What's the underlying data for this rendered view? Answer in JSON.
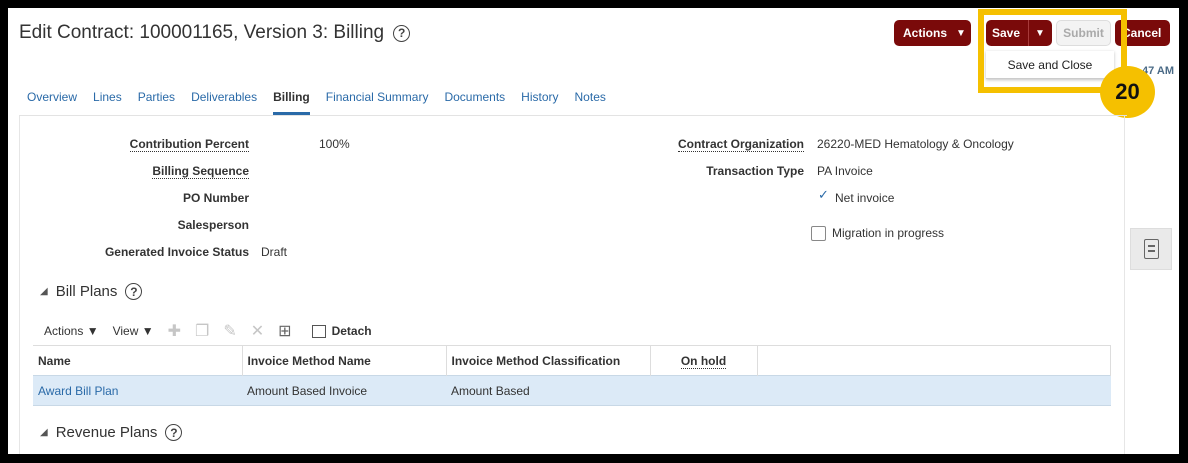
{
  "header": {
    "title": "Edit Contract: 100001165, Version 3: Billing",
    "help_glyph": "?",
    "timestamp": "47 AM"
  },
  "toolbar_buttons": {
    "actions_label": "Actions",
    "save_label": "Save",
    "submit_label": "Submit",
    "cancel_label": "Cancel"
  },
  "save_menu": {
    "items": [
      "Save and Close"
    ]
  },
  "annotation": {
    "step_number": "20",
    "highlight_color": "#f5c000"
  },
  "tabs": [
    {
      "label": "Overview"
    },
    {
      "label": "Lines"
    },
    {
      "label": "Parties"
    },
    {
      "label": "Deliverables"
    },
    {
      "label": "Billing",
      "active": true
    },
    {
      "label": "Financial Summary"
    },
    {
      "label": "Documents"
    },
    {
      "label": "History"
    },
    {
      "label": "Notes"
    }
  ],
  "billing": {
    "contribution_percent_label": "Contribution Percent",
    "contribution_percent_value": "100%",
    "billing_sequence_label": "Billing Sequence",
    "po_number_label": "PO Number",
    "salesperson_label": "Salesperson",
    "generated_invoice_status_label": "Generated Invoice Status",
    "generated_invoice_status_value": "Draft",
    "contract_organization_label": "Contract Organization",
    "contract_organization_value": "26220-MED Hematology & Oncology",
    "transaction_type_label": "Transaction Type",
    "transaction_type_value": "PA Invoice",
    "net_invoice_label": "Net invoice",
    "migration_label": "Migration in progress"
  },
  "bill_plans": {
    "title": "Bill Plans",
    "actions_menu": "Actions",
    "view_menu": "View",
    "detach_label": "Detach",
    "columns": [
      "Name",
      "Invoice Method Name",
      "Invoice Method Classification",
      "On hold"
    ],
    "rows": [
      {
        "name": "Award Bill Plan",
        "invoice_method_name": "Amount Based Invoice",
        "classification": "Amount Based",
        "on_hold": ""
      }
    ]
  },
  "revenue_plans": {
    "title": "Revenue Plans"
  },
  "colors": {
    "brand_button": "#7a0a0a",
    "link": "#2a6aa8",
    "selected_row": "#dceaf7"
  }
}
